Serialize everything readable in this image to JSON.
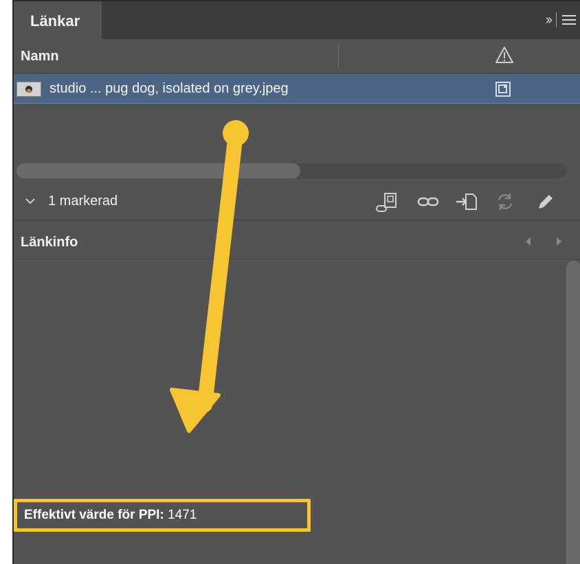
{
  "panel": {
    "tab_title": "Länkar",
    "column_header": "Namn",
    "row_filename": "studio ... pug dog, isolated on grey.jpeg",
    "selection_label": "1 markerad",
    "info_title": "Länkinfo",
    "ppi_label": "Effektivt värde för PPI:",
    "ppi_value": "1471"
  },
  "icons": {
    "tab_expand": "double-chevron-right-icon",
    "panel_menu": "hamburger-menu-icon",
    "missing_status": "warning-triangle-icon",
    "embedded_status": "embedded-link-icon",
    "toolbar": [
      "relink-from-library-icon",
      "relink-icon",
      "go-to-link-icon",
      "update-link-icon",
      "edit-original-icon"
    ]
  },
  "colors": {
    "panel_bg": "#535353",
    "tab_bar": "#3c3c3c",
    "selected_row": "#4c6584",
    "annotation_yellow": "#f7c531"
  }
}
